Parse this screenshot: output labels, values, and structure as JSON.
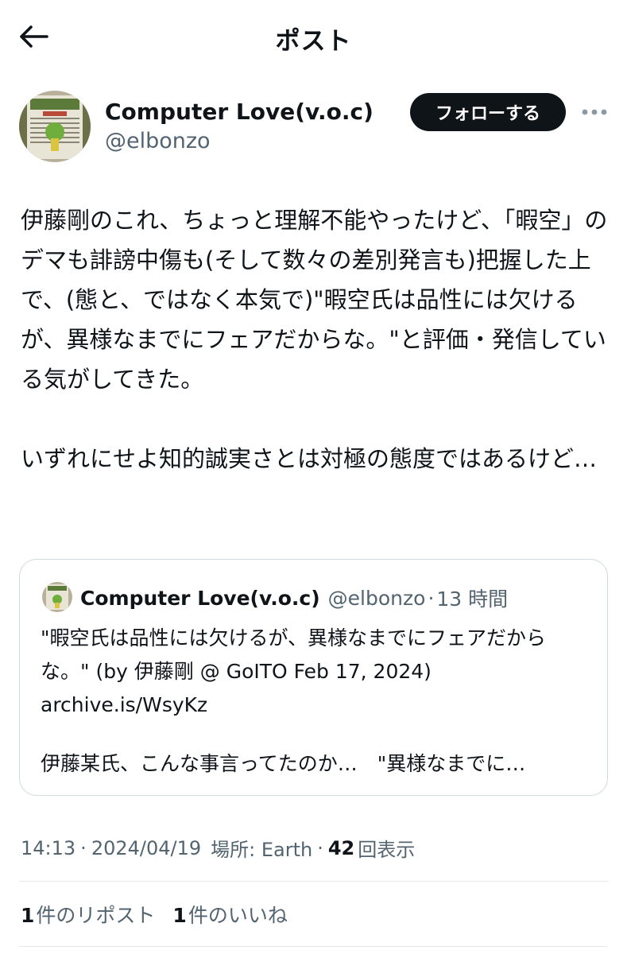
{
  "header": {
    "title": "ポスト"
  },
  "author": {
    "display_name": "Computer Love(v.o.c)",
    "handle": "@elbonzo",
    "follow_label": "フォローする"
  },
  "tweet": {
    "text": "伊藤剛のこれ、ちょっと理解不能やったけど、「暇空」のデマも誹謗中傷も(そして数々の差別発言も)把握した上で、(態と、ではなく本気で)\"暇空氏は品性には欠けるが、異様なまでにフェアだからな。\"と評価・発信している気がしてきた。\n\nいずれにせよ知的誠実さとは対極の態度ではあるけど…"
  },
  "quote": {
    "display_name": "Computer Love(v.o.c)",
    "handle": "@elbonzo",
    "separator": "·",
    "time": "13 時間",
    "text": "\"暇空氏は品性には欠けるが、異様なまでにフェアだからな。\" (by 伊藤剛 @ GoITO Feb 17, 2024)\narchive.is/WsyKz",
    "bottom_text": "伊藤某氏、こんな事言ってたのか…　\"異様なまでに…"
  },
  "meta": {
    "time": "14:13",
    "sep1": "·",
    "date": "2024/04/19",
    "location": "場所: Earth",
    "sep2": "·",
    "views_count": "42",
    "views_label": "回表示"
  },
  "stats": {
    "reposts_count": "1",
    "reposts_label": "件のリポスト",
    "likes_count": "1",
    "likes_label": "件のいいね"
  }
}
